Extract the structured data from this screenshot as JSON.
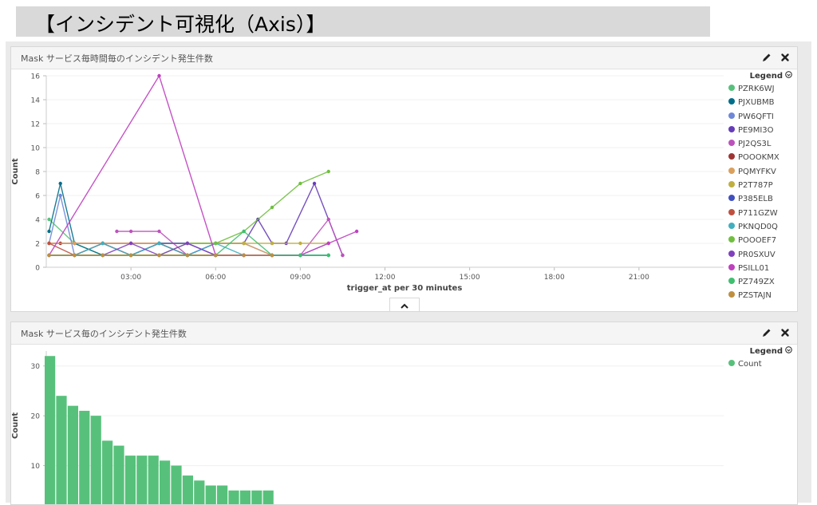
{
  "page": {
    "title": "【インシデント可視化（Axis）】"
  },
  "panel1": {
    "title": "Mask サービス毎時間毎のインシデント発生件数",
    "legend_title": "Legend",
    "collapse_icon": "chevron-up-icon",
    "tools": [
      "pencil-icon",
      "close-icon"
    ]
  },
  "panel2": {
    "title": "Mask サービス毎のインシデント発生件数",
    "legend_title": "Legend",
    "tools": [
      "pencil-icon",
      "close-icon"
    ]
  },
  "chart_data": [
    {
      "type": "line",
      "xlabel": "trigger_at per 30 minutes",
      "ylabel": "Count",
      "x_unit": "hours",
      "xlim": [
        0,
        24
      ],
      "ylim": [
        0,
        16
      ],
      "y_ticks": [
        0,
        2,
        4,
        6,
        8,
        10,
        12,
        14,
        16
      ],
      "x_ticks": [
        {
          "value": 3,
          "label": "03:00"
        },
        {
          "value": 6,
          "label": "06:00"
        },
        {
          "value": 9,
          "label": "09:00"
        },
        {
          "value": 12,
          "label": "12:00"
        },
        {
          "value": 15,
          "label": "15:00"
        },
        {
          "value": 18,
          "label": "18:00"
        },
        {
          "value": 21,
          "label": "21:00"
        }
      ],
      "grid": true,
      "legend_position": "right",
      "series": [
        {
          "name": "PZRK6WJ",
          "color": "#57c17b",
          "points": [
            [
              0.1,
              4
            ],
            [
              1,
              2
            ],
            [
              2,
              1
            ],
            [
              3,
              1
            ],
            [
              4,
              1
            ],
            [
              5,
              1
            ],
            [
              6,
              1
            ],
            [
              7,
              1
            ],
            [
              8,
              1
            ],
            [
              9,
              1
            ],
            [
              10,
              1
            ]
          ]
        },
        {
          "name": "PJXUBMB",
          "color": "#006e8a",
          "points": [
            [
              0.1,
              3
            ],
            [
              0.5,
              7
            ],
            [
              1,
              2
            ],
            [
              2,
              1
            ],
            [
              3,
              1
            ],
            [
              4,
              1
            ],
            [
              5,
              1
            ],
            [
              6,
              1
            ],
            [
              7,
              1
            ],
            [
              8,
              1
            ],
            [
              9,
              1
            ],
            [
              10,
              1
            ]
          ]
        },
        {
          "name": "PW6QFTI",
          "color": "#6f87d8",
          "points": [
            [
              0.1,
              2
            ],
            [
              0.5,
              6
            ],
            [
              1,
              1
            ],
            [
              2,
              1
            ],
            [
              3,
              1
            ],
            [
              4,
              1
            ],
            [
              5,
              1
            ],
            [
              6,
              2
            ],
            [
              7,
              2
            ],
            [
              8,
              1
            ],
            [
              9,
              1
            ],
            [
              10,
              2
            ]
          ]
        },
        {
          "name": "PE9MI3O",
          "color": "#663db8",
          "points": [
            [
              0.1,
              1
            ],
            [
              1,
              1
            ],
            [
              2,
              2
            ],
            [
              3,
              1
            ],
            [
              4,
              2
            ],
            [
              5,
              1
            ],
            [
              6,
              2
            ],
            [
              7,
              2
            ],
            [
              7.5,
              4
            ],
            [
              8,
              2
            ],
            [
              8.5,
              2
            ],
            [
              9.5,
              7
            ],
            [
              10.5,
              1
            ]
          ]
        },
        {
          "name": "PJ2QS3L",
          "color": "#bc52bc",
          "points": [
            [
              2.5,
              3
            ],
            [
              3,
              3
            ],
            [
              4,
              3
            ],
            [
              5,
              1
            ],
            [
              6,
              1
            ],
            [
              7,
              1
            ],
            [
              8,
              1
            ],
            [
              9,
              1
            ],
            [
              10,
              4
            ],
            [
              10.5,
              1
            ]
          ]
        },
        {
          "name": "POOOKMX",
          "color": "#9e3533",
          "points": [
            [
              0.1,
              2
            ],
            [
              0.5,
              2
            ],
            [
              1,
              2
            ],
            [
              2,
              2
            ],
            [
              3,
              2
            ],
            [
              4,
              2
            ],
            [
              5,
              1
            ],
            [
              6,
              1
            ],
            [
              7,
              1
            ],
            [
              8,
              1
            ],
            [
              9,
              1
            ]
          ]
        },
        {
          "name": "PQMYFKV",
          "color": "#daa05d",
          "points": [
            [
              0.1,
              2
            ],
            [
              1,
              2
            ],
            [
              2,
              2
            ],
            [
              3,
              2
            ],
            [
              4,
              2
            ],
            [
              5,
              2
            ],
            [
              6,
              2
            ],
            [
              7,
              2
            ],
            [
              8,
              1
            ],
            [
              9,
              1
            ]
          ]
        },
        {
          "name": "P2T787P",
          "color": "#bfaf40",
          "points": [
            [
              0.1,
              1
            ],
            [
              1,
              1
            ],
            [
              2,
              1
            ],
            [
              3,
              1
            ],
            [
              4,
              2
            ],
            [
              5,
              2
            ],
            [
              6,
              2
            ],
            [
              7,
              2
            ],
            [
              8,
              2
            ],
            [
              9,
              2
            ],
            [
              10,
              2
            ]
          ]
        },
        {
          "name": "P385ELB",
          "color": "#4050bf",
          "points": [
            [
              0.1,
              1
            ],
            [
              1,
              1
            ],
            [
              2,
              1
            ],
            [
              3,
              1
            ],
            [
              4,
              2
            ],
            [
              5,
              2
            ],
            [
              6,
              1
            ],
            [
              7,
              1
            ],
            [
              8,
              1
            ],
            [
              9,
              1
            ]
          ]
        },
        {
          "name": "P711GZW",
          "color": "#bf5040",
          "points": [
            [
              0.1,
              2
            ],
            [
              1,
              1
            ],
            [
              2,
              2
            ],
            [
              3,
              1
            ],
            [
              4,
              1
            ],
            [
              5,
              1
            ],
            [
              6,
              1
            ],
            [
              7,
              1
            ],
            [
              8,
              1
            ]
          ]
        },
        {
          "name": "PKNQD0Q",
          "color": "#40afbf",
          "points": [
            [
              0.1,
              1
            ],
            [
              1,
              1
            ],
            [
              2,
              2
            ],
            [
              3,
              1
            ],
            [
              4,
              2
            ],
            [
              5,
              1
            ],
            [
              6,
              2
            ],
            [
              7,
              1
            ],
            [
              8,
              1
            ],
            [
              9,
              1
            ],
            [
              10,
              1
            ]
          ]
        },
        {
          "name": "POOOEF7",
          "color": "#70bf40",
          "points": [
            [
              0.1,
              1
            ],
            [
              1,
              1
            ],
            [
              2,
              1
            ],
            [
              3,
              1
            ],
            [
              4,
              1
            ],
            [
              5,
              2
            ],
            [
              6,
              2
            ],
            [
              7,
              3
            ],
            [
              8,
              5
            ],
            [
              9,
              7
            ],
            [
              10,
              8
            ]
          ]
        },
        {
          "name": "PR0SXUV",
          "color": "#8040bf",
          "points": [
            [
              0.1,
              1
            ],
            [
              1,
              1
            ],
            [
              2,
              1
            ],
            [
              3,
              2
            ],
            [
              4,
              1
            ],
            [
              5,
              2
            ],
            [
              6,
              1
            ],
            [
              7,
              1
            ],
            [
              8,
              1
            ]
          ]
        },
        {
          "name": "PSILL01",
          "color": "#bf40bf",
          "points": [
            [
              0.1,
              1
            ],
            [
              4,
              16
            ],
            [
              6,
              1
            ],
            [
              7,
              1
            ],
            [
              8,
              1
            ],
            [
              9,
              1
            ],
            [
              10,
              2
            ],
            [
              11,
              3
            ]
          ]
        },
        {
          "name": "PZ749ZX",
          "color": "#40bf70",
          "points": [
            [
              0.1,
              1
            ],
            [
              1,
              1
            ],
            [
              2,
              1
            ],
            [
              3,
              1
            ],
            [
              4,
              1
            ],
            [
              5,
              1
            ],
            [
              6,
              1
            ],
            [
              7,
              3
            ],
            [
              8,
              1
            ],
            [
              9,
              1
            ],
            [
              10,
              1
            ]
          ]
        },
        {
          "name": "PZSTAJN",
          "color": "#bf8f40",
          "points": [
            [
              0.1,
              1
            ],
            [
              1,
              1
            ],
            [
              2,
              1
            ],
            [
              3,
              1
            ],
            [
              4,
              1
            ],
            [
              5,
              1
            ],
            [
              6,
              1
            ],
            [
              7,
              1
            ],
            [
              8,
              1
            ]
          ]
        }
      ]
    },
    {
      "type": "bar",
      "xlabel": "",
      "ylabel": "Count",
      "ylim": [
        0,
        33
      ],
      "y_ticks": [
        10,
        20,
        30
      ],
      "grid": true,
      "legend_position": "right",
      "series": [
        {
          "name": "Count",
          "color": "#57c17b",
          "values": [
            32,
            24,
            22,
            21,
            20,
            15,
            14,
            12,
            12,
            12,
            11,
            10,
            8,
            7,
            6,
            6,
            5,
            5,
            5,
            5
          ]
        }
      ]
    }
  ]
}
